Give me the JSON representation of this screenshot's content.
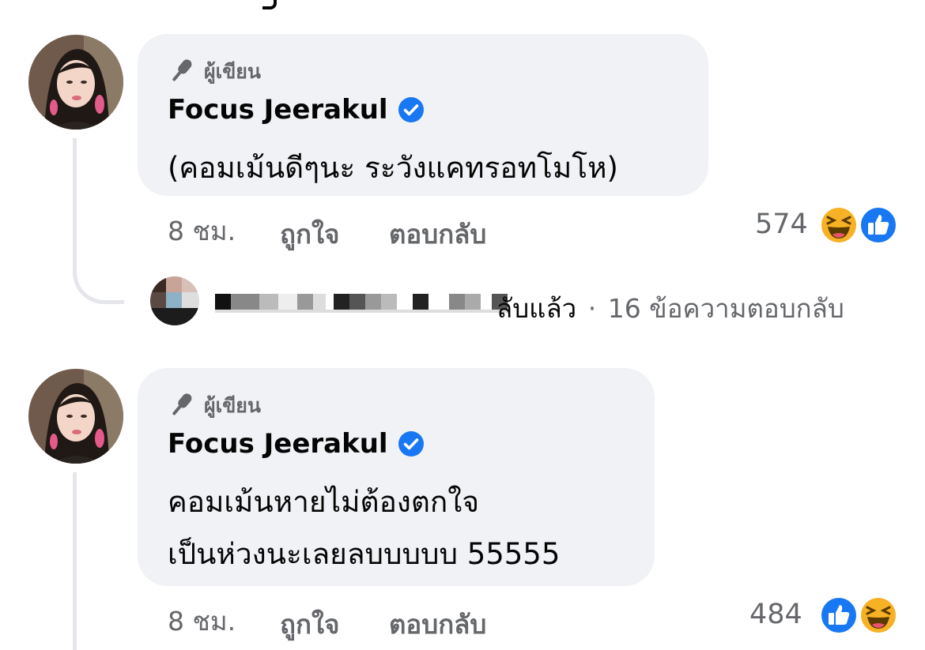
{
  "comments": [
    {
      "author_badge": "ผู้เขียน",
      "author_name": "Focus Jeerakul",
      "lines": [
        "(คอมเม้นดีๆนะ ระวังแคทรอทโมโห)"
      ],
      "time": "8 ชม.",
      "like_label": "ถูกใจ",
      "reply_label": "ตอบกลับ",
      "reaction_count": "574",
      "reaction_icons": [
        "haha-icon",
        "like-icon"
      ]
    },
    {
      "author_badge": "ผู้เขียน",
      "author_name": "Focus Jeerakul",
      "lines": [
        "คอมเม้นหายไม่ต้องตกใจ",
        "เป็นห่วงนะเลยลบบบบบ 55555"
      ],
      "time": "8 ชม.",
      "like_label": "ถูกใจ",
      "reply_label": "ตอบกลับ",
      "reaction_count": "484",
      "reaction_icons": [
        "like-icon",
        "haha-icon"
      ]
    }
  ],
  "reply_summary": {
    "replied_suffix": "ลับแล้ว",
    "separator": "·",
    "reply_count_text": "16 ข้อความตอบกลับ"
  },
  "colors": {
    "bubble": "#f0f2f5",
    "secondary_text": "#65676b",
    "verified_blue": "#1877f2",
    "haha_yellow": "#f7b125"
  }
}
